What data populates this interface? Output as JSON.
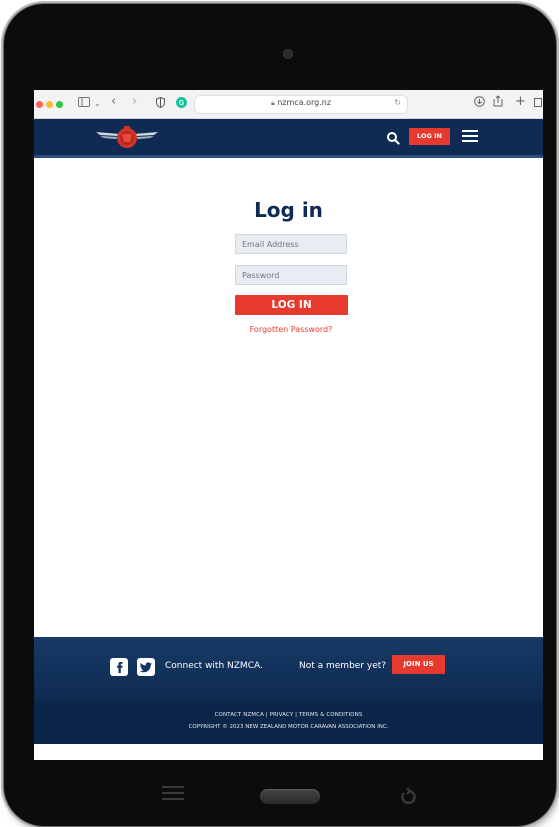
{
  "browser": {
    "url": "nzmca.org.nz"
  },
  "header": {
    "login_label": "LOG IN"
  },
  "main": {
    "title": "Log in",
    "email_placeholder": "Email Address",
    "password_placeholder": "Password",
    "login_button": "LOG IN",
    "forgot_link": "Forgotten Password?"
  },
  "footer": {
    "connect_text": "Connect with NZMCA.",
    "not_member_text": "Not a member yet?",
    "join_button": "JOIN US",
    "links_line": "CONTACT NZMCA  |  PRIVACY  |  TERMS & CONDITIONS",
    "copyright": "COPYRIGHT © 2023 NEW ZEALAND MOTOR CARAVAN ASSOCIATION INC."
  },
  "colors": {
    "navy": "#0f2b53",
    "accent_red": "#e63a2e"
  },
  "icons": [
    "traffic-light-buttons",
    "sidebar-icon",
    "back-icon",
    "forward-icon",
    "shield-icon",
    "grammarly-icon",
    "lock-icon",
    "reload-icon",
    "download-icon",
    "share-icon",
    "new-tab-icon",
    "search-icon",
    "menu-icon",
    "facebook-icon",
    "twitter-icon"
  ]
}
